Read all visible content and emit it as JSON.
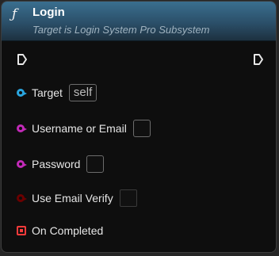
{
  "node": {
    "title": "Login",
    "subtitle": "Target is Login System Pro Subsystem",
    "function_icon": "function-icon",
    "header_color": "#2f5876"
  },
  "pins": {
    "target": {
      "label": "Target",
      "value": "self",
      "color": "#2aa6e0"
    },
    "username": {
      "label": "Username or Email",
      "value": "",
      "color": "#c22ab8"
    },
    "password": {
      "label": "Password",
      "value": "",
      "color": "#c22ab8"
    },
    "use_email_verify": {
      "label": "Use Email Verify",
      "checked": false,
      "color": "#6b0000"
    },
    "on_completed": {
      "label": "On Completed",
      "color": "#ff3b3b"
    }
  }
}
